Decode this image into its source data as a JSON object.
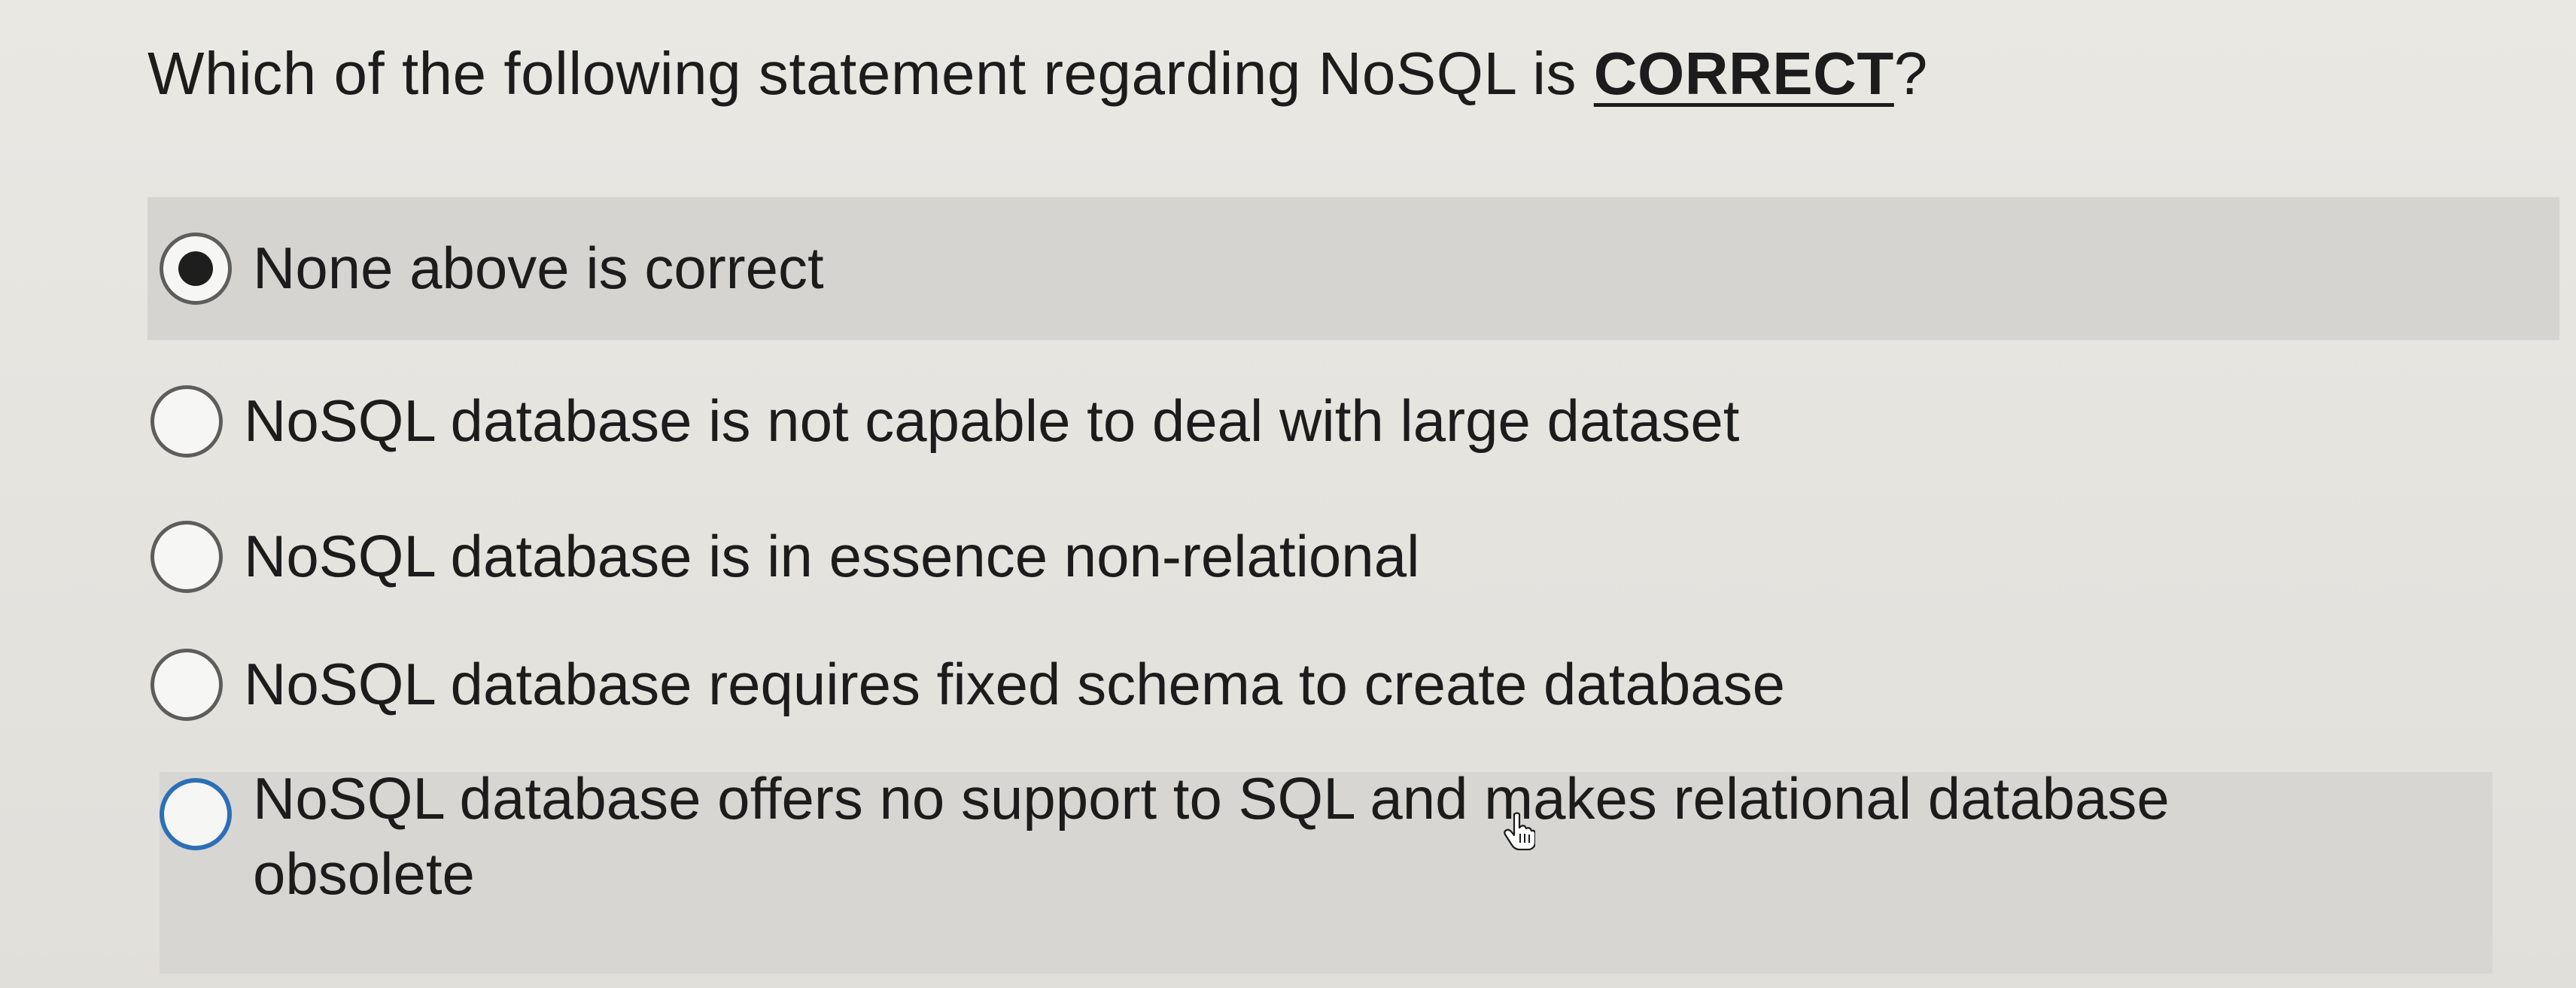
{
  "question": {
    "prefix": "Which of the following statement regarding NoSQL is ",
    "emphasis": "CORRECT",
    "suffix": "?"
  },
  "options": [
    {
      "label": "None above is correct",
      "selected": true
    },
    {
      "label": "NoSQL database is not capable to deal with large dataset",
      "selected": false
    },
    {
      "label": "NoSQL database is in essence non-relational",
      "selected": false
    },
    {
      "label": "NoSQL database requires fixed schema to create database",
      "selected": false
    },
    {
      "label": "NoSQL database offers no support to SQL and makes relational database obsolete",
      "selected": false
    }
  ],
  "colors": {
    "selected_row": "#d5d4d0",
    "focus_ring": "#2c6fb6",
    "radio_dot": "#1e1e1e"
  },
  "icons": {
    "cursor": "hand-pointer-icon"
  }
}
